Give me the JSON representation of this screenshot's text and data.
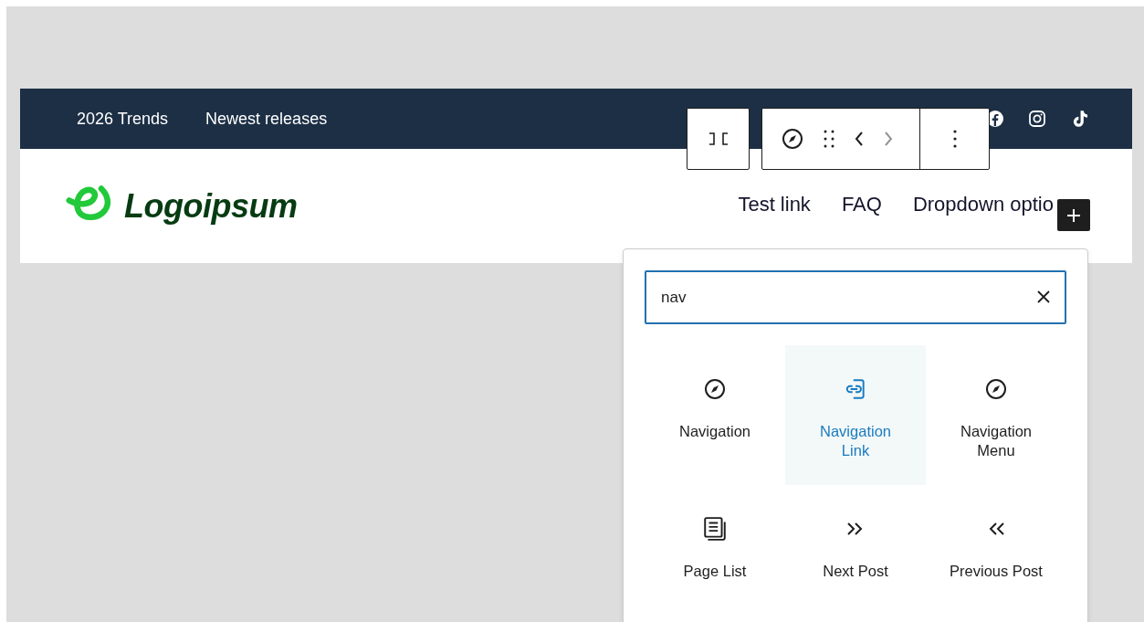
{
  "top_bar": {
    "links": [
      "2026 Trends",
      "Newest releases"
    ]
  },
  "header": {
    "logo_text": "Logoipsum",
    "nav_links": [
      "Test link",
      "FAQ",
      "Dropdown optio"
    ]
  },
  "inserter": {
    "search": {
      "value": "nav"
    },
    "blocks": [
      {
        "label": "Navigation",
        "selected": false
      },
      {
        "label": "Navigation Link",
        "selected": true
      },
      {
        "label": "Navigation Menu",
        "selected": false
      },
      {
        "label": "Page List",
        "selected": false
      },
      {
        "label": "Next Post",
        "selected": false
      },
      {
        "label": "Previous Post",
        "selected": false
      }
    ]
  }
}
